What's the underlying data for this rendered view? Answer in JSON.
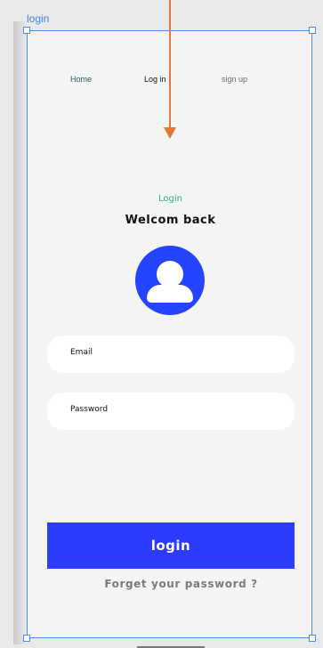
{
  "frame": {
    "label": "login"
  },
  "nav": {
    "home": "Home",
    "login": "Log in",
    "signup": "sign up"
  },
  "header": {
    "subtitle": "Login",
    "title": "Welcom back"
  },
  "form": {
    "email_placeholder": "Email",
    "password_placeholder": "Password",
    "login_button": "login",
    "forgot_password": "Forget your password ?"
  },
  "icons": {
    "avatar": "user-avatar-icon",
    "arrow": "arrow-down-icon"
  },
  "colors": {
    "accent": "#2c3cff",
    "subtitle": "#26b38a",
    "arrow": "#e2792f",
    "frame": "#4a90e2"
  }
}
